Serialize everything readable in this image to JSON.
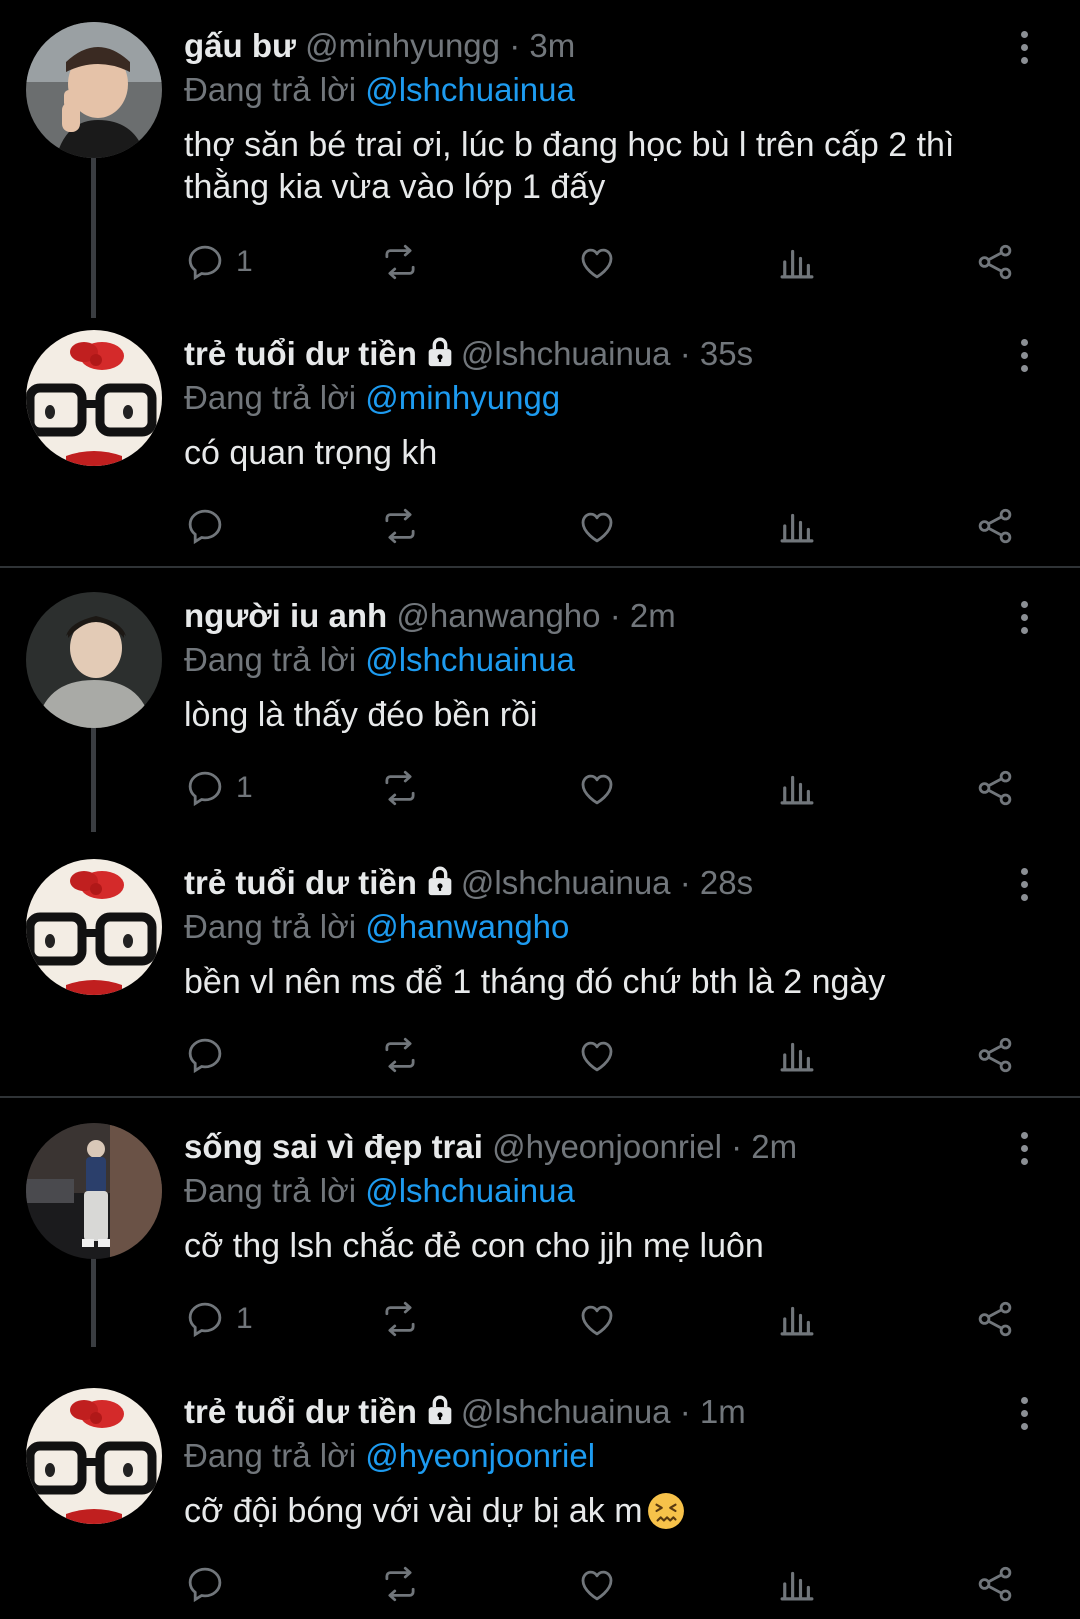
{
  "reply_prefix": "Đang trả lời",
  "colors": {
    "background": "#000000",
    "mention": "#1d9bf0",
    "muted": "#71767b",
    "text": "#e7e9ea"
  },
  "tweets": [
    {
      "name": "gấu bư",
      "handle": "@minhyungg",
      "time": "· 3m",
      "locked": false,
      "reply_to": "@lshchuainua",
      "text": "thợ săn bé trai ơi, lúc b đang học bù l trên cấp 2 thì thằng kia vừa vào lớp 1 đấy",
      "reply_count": "1",
      "avatar": "person-thumbs-up"
    },
    {
      "name": "trẻ tuổi dư tiền",
      "handle": "@lshchuainua",
      "time": "· 35s",
      "locked": true,
      "reply_to": "@minhyungg",
      "text": "có quan trọng kh",
      "reply_count": "",
      "avatar": "hello-kitty-glasses"
    },
    {
      "name": "người iu anh",
      "handle": "@hanwangho",
      "time": "· 2m",
      "locked": false,
      "reply_to": "@lshchuainua",
      "text": "lòng là thấy đéo bền rồi",
      "reply_count": "1",
      "avatar": "person-hoodie"
    },
    {
      "name": "trẻ tuổi dư tiền",
      "handle": "@lshchuainua",
      "time": "· 28s",
      "locked": true,
      "reply_to": "@hanwangho",
      "text": "bền vl nên ms để 1 tháng đó chứ bth là 2 ngày",
      "reply_count": "",
      "avatar": "hello-kitty-glasses"
    },
    {
      "name": "sống sai vì đẹp trai",
      "handle": "@hyeonjoonriel",
      "time": "· 2m",
      "locked": false,
      "reply_to": "@lshchuainua",
      "text": "cỡ thg lsh chắc đẻ con cho jjh mẹ luôn",
      "reply_count": "1",
      "avatar": "person-street"
    },
    {
      "name": "trẻ tuổi dư tiền",
      "handle": "@lshchuainua",
      "time": "· 1m",
      "locked": true,
      "reply_to": "@hyeonjoonriel",
      "text": "cỡ đội bóng với vài dự bị ak m",
      "reply_count": "",
      "avatar": "hello-kitty-glasses",
      "emoji": "confounded-face"
    }
  ]
}
